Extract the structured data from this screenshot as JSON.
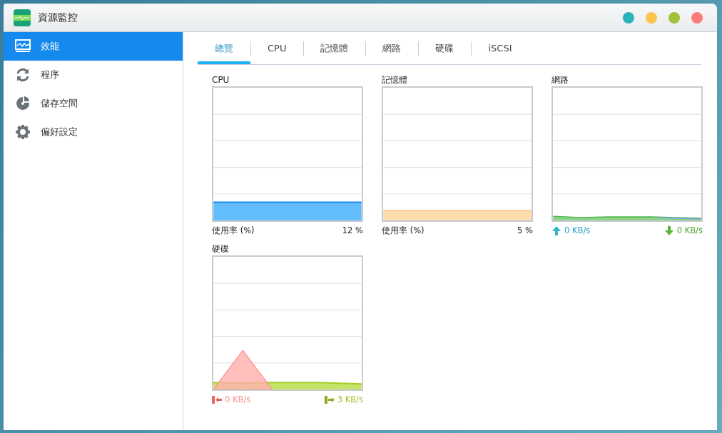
{
  "window": {
    "title": "資源監控",
    "controls": [
      {
        "color": "#2ab3b8"
      },
      {
        "color": "#fcc54f"
      },
      {
        "color": "#a1c33a"
      },
      {
        "color": "#fb7b7b"
      }
    ]
  },
  "sidebar": {
    "items": [
      {
        "label": "效能",
        "kind": "performance",
        "selected": true
      },
      {
        "label": "程序",
        "kind": "process",
        "selected": false
      },
      {
        "label": "儲存空間",
        "kind": "storage",
        "selected": false
      },
      {
        "label": "偏好設定",
        "kind": "settings",
        "selected": false
      }
    ]
  },
  "tabs": [
    {
      "label": "總覽",
      "selected": true
    },
    {
      "label": "CPU",
      "selected": false
    },
    {
      "label": "記憶體",
      "selected": false
    },
    {
      "label": "網路",
      "selected": false
    },
    {
      "label": "硬碟",
      "selected": false
    },
    {
      "label": "iSCSI",
      "selected": false
    }
  ],
  "panels": [
    {
      "title": "CPU",
      "kind": "cpu",
      "caption": "使用率 (%)",
      "reading": "12 %"
    },
    {
      "title": "記憶體",
      "kind": "memory",
      "caption": "使用率 (%)",
      "reading": "5 %"
    },
    {
      "title": "網路",
      "kind": "network",
      "rates": [
        {
          "kind": "upload",
          "text": "0 KB/s"
        },
        {
          "kind": "download",
          "text": "0 KB/s"
        }
      ]
    },
    {
      "title": "硬碟",
      "kind": "disk",
      "rates": [
        {
          "kind": "read",
          "text": "0 KB/s"
        },
        {
          "kind": "write",
          "text": "3 KB/s"
        }
      ]
    }
  ]
}
